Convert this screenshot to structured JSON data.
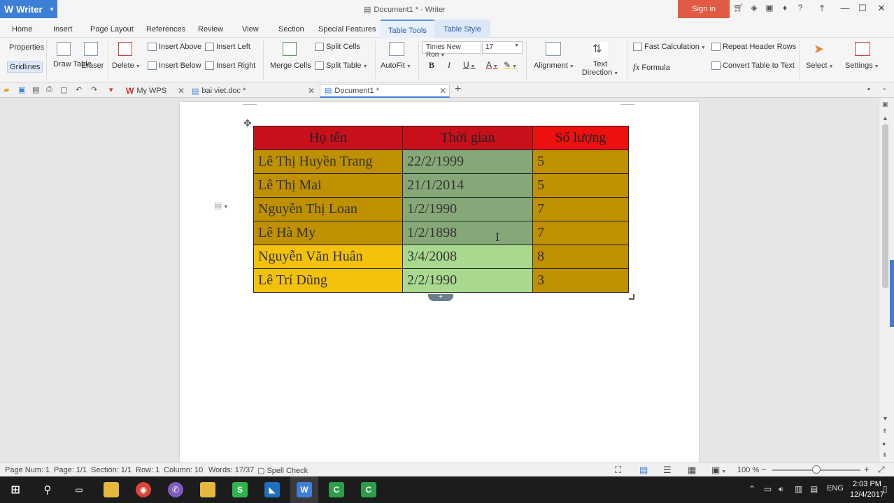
{
  "app": {
    "name": "Writer",
    "logo": "W"
  },
  "window": {
    "title": "Document1 * - Writer",
    "signin": "Sign in"
  },
  "menu_tabs": [
    "Home",
    "Insert",
    "Page Layout",
    "References",
    "Review",
    "View",
    "Section",
    "Special Features",
    "Table Tools",
    "Table Style"
  ],
  "ribbon": {
    "properties": "Properties",
    "gridlines": "Gridlines",
    "draw_table": "Draw Table",
    "eraser": "Eraser",
    "delete": "Delete",
    "insert_above": "Insert Above",
    "insert_below": "Insert Below",
    "insert_left": "Insert Left",
    "insert_right": "Insert Right",
    "merge_cells": "Merge Cells",
    "split_cells": "Split Cells",
    "split_table": "Split Table",
    "autofit": "AutoFit",
    "font_name": "Times New Ron",
    "font_size": "17",
    "alignment": "Alignment",
    "text_direction": "Text Direction",
    "fast_calculation": "Fast Calculation",
    "formula": "Formula",
    "repeat_header_rows": "Repeat Header Rows",
    "convert_table_to_text": "Convert Table to Text",
    "select": "Select",
    "settings": "Settings"
  },
  "doc_tabs": [
    {
      "label": "My WPS"
    },
    {
      "label": "bai viet.doc *"
    },
    {
      "label": "Document1 *"
    }
  ],
  "table": {
    "headers": [
      "Họ tên",
      "Thời gian",
      "Số lượng"
    ],
    "rows": [
      [
        "Lê Thị Huyền Trang",
        "22/2/1999",
        "5"
      ],
      [
        "Lê Thị Mai",
        "21/1/2014",
        "5"
      ],
      [
        "Nguyễn Thị Loan",
        "1/2/1990",
        "7"
      ],
      [
        "Lê Hà My",
        "1/2/1898",
        "7"
      ],
      [
        "Nguyễn Văn Huân",
        "3/4/2008",
        "8"
      ],
      [
        "Lê Trí Dũng",
        "2/2/1990",
        "3"
      ]
    ],
    "colors": {
      "header_red": "#c8101a",
      "header_bright_red": "#ee0f0f",
      "gold": "#bf9000",
      "yellow": "#f4c10c",
      "green_dark": "#86a878",
      "green_light": "#a9d98e"
    }
  },
  "status": {
    "page_num": "Page Num: 1",
    "page": "Page: 1/1",
    "section": "Section: 1/1",
    "row": "Row: 1",
    "column": "Column: 10",
    "words": "Words: 17/37",
    "spell_check": "Spell Check",
    "zoom": "100 %"
  },
  "taskbar": {
    "language": "ENG",
    "time": "2:03 PM",
    "date": "12/4/2017"
  }
}
